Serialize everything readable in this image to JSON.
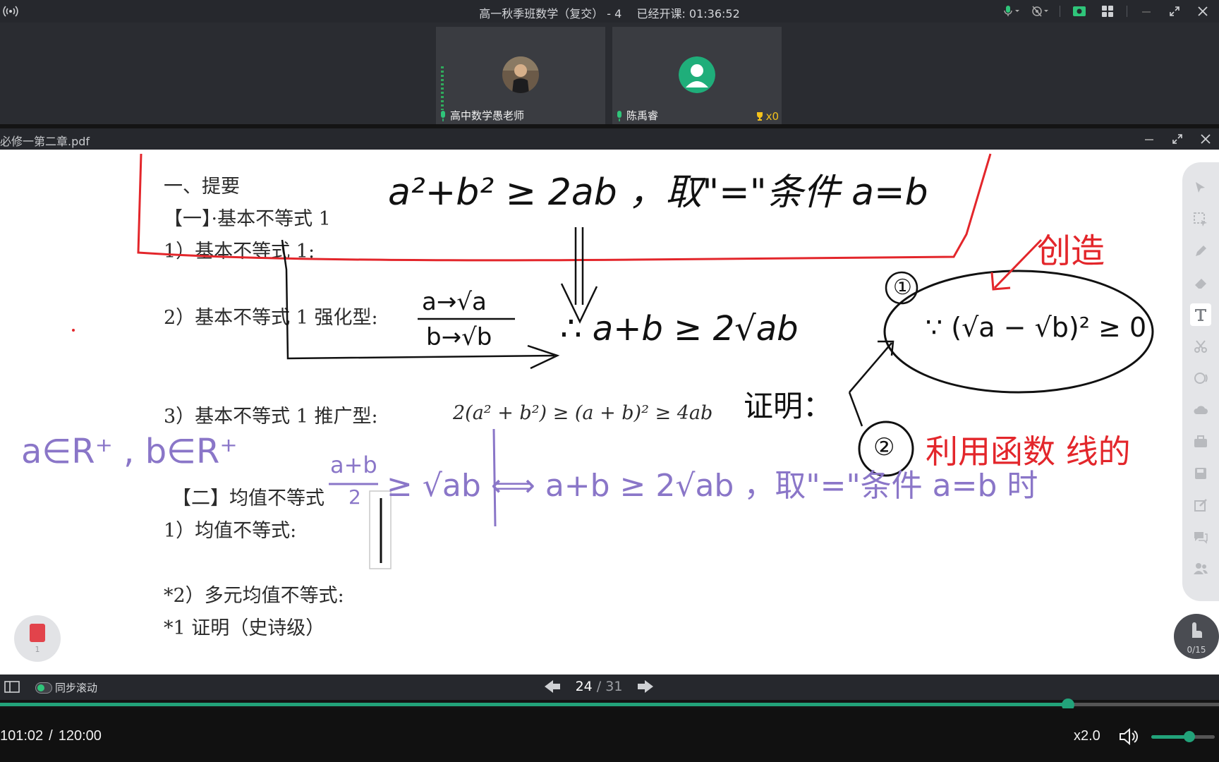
{
  "app": {
    "title": "高一秋季班数学（复交） - 4",
    "class_timer": "已经开课: 01:36:52"
  },
  "participants": [
    {
      "name": "高中数学愚老师",
      "avatar": "teacher-photo"
    },
    {
      "name": "陈禹睿",
      "avatar": "default-user-avatar",
      "trophies": "x0"
    }
  ],
  "document": {
    "filename": "必修一第二章.pdf",
    "lines": {
      "section": "一、提要",
      "part1": "【一】·基本不等式 1",
      "item1": "1）基本不等式 1:",
      "item2": "2）基本不等式 1 强化型:",
      "item3": "3）基本不等式 1 推广型:",
      "item3_formula": "2(a² + b²) ≥ (a + b)² ≥  4ab",
      "part2": "【二】均值不等式",
      "item4": "1）均值不等式:",
      "item5": "*2）多元均值不等式:",
      "item6": "*1 证明（史诗级）"
    },
    "annotations": {
      "top_formula": "a²+b² ≥ 2ab ，取\"=\"条件  a=b",
      "subst_top": "a→√a",
      "subst_bottom": "b→√b",
      "derived": "∴ a+b ≥ 2√ab",
      "proof_label": "证明：",
      "proof_one_num": "①",
      "proof_one": "∵ (√a − √b)² ≥ 0",
      "create_label": "创造",
      "proof_two_num": "②",
      "proof_two": "利用函数 线的",
      "domain_note": "a∈R⁺ , b∈R⁺",
      "mean_frac_num": "a+b",
      "mean_frac_den": "2",
      "mean_rest": "≥ √ab ⟺ a+b ≥ 2√ab ，取\"=\"条件  a=b 时"
    },
    "pdf_badge_page": "1",
    "raise_hand_count": "0/15"
  },
  "tools": [
    "pointer-icon",
    "select-icon",
    "pen-icon",
    "eraser-icon",
    "text-icon",
    "scissors-icon",
    "shape-icon",
    "cloud-icon",
    "toolbox-icon",
    "save-icon",
    "edit-icon",
    "chat-icon",
    "users-icon"
  ],
  "pager": {
    "current": "24",
    "total": "31",
    "sync_label": "同步滚动"
  },
  "player": {
    "current_time": "101:02",
    "total_time": "120:00",
    "progress_fraction": 0.876,
    "speed": "x2.0",
    "volume_fraction": 0.6
  },
  "colors": {
    "accent": "#22a37a",
    "ink_red": "#e3262b",
    "ink_black": "#111111",
    "ink_purple": "#8a76c8"
  }
}
